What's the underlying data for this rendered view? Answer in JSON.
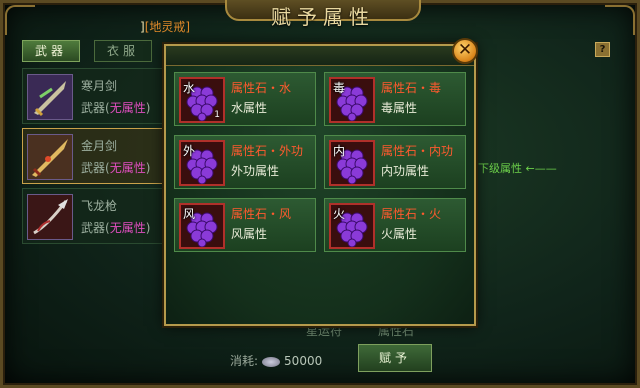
{
  "window": {
    "title": "赋予属性"
  },
  "tabs": [
    {
      "label": "武器",
      "active": true
    },
    {
      "label": "衣服",
      "active": false
    }
  ],
  "help_label": "?",
  "ring_label": {
    "prefix": "]",
    "name": "[地灵戒]"
  },
  "items": [
    {
      "name": "寒月剑",
      "type_prefix": "武器(",
      "attr": "无属性",
      "type_suffix": ")",
      "icon": "sword-icon"
    },
    {
      "name": "金月剑",
      "type_prefix": "武器(",
      "attr": "无属性",
      "type_suffix": ")",
      "icon": "sword-icon",
      "selected": true
    },
    {
      "name": "飞龙枪",
      "type_prefix": "武器(",
      "attr": "无属性",
      "type_suffix": ")",
      "icon": "spear-icon"
    }
  ],
  "side_hint": "下级属性 ←——",
  "bottom_labels": [
    "星运符",
    "属性石"
  ],
  "cost": {
    "label": "消耗:",
    "value": "50000"
  },
  "assign_label": "赋予",
  "popup": {
    "close_label": "✕",
    "stones": [
      {
        "char": "水",
        "title": "属性石・水",
        "subtitle": "水属性",
        "count": "1"
      },
      {
        "char": "毒",
        "title": "属性石・毒",
        "subtitle": "毒属性",
        "count": ""
      },
      {
        "char": "外",
        "title": "属性石・外功",
        "subtitle": "外功属性",
        "count": ""
      },
      {
        "char": "内",
        "title": "属性石・内功",
        "subtitle": "内功属性",
        "count": ""
      },
      {
        "char": "风",
        "title": "属性石・风",
        "subtitle": "风属性",
        "count": ""
      },
      {
        "char": "火",
        "title": "属性石・火",
        "subtitle": "火属性",
        "count": ""
      }
    ]
  },
  "colors": {
    "stone_title": "#ff5a2e",
    "no_attr": "#e04ec0",
    "hint": "#6ccf4a",
    "gold_border": "#b59a4c"
  }
}
